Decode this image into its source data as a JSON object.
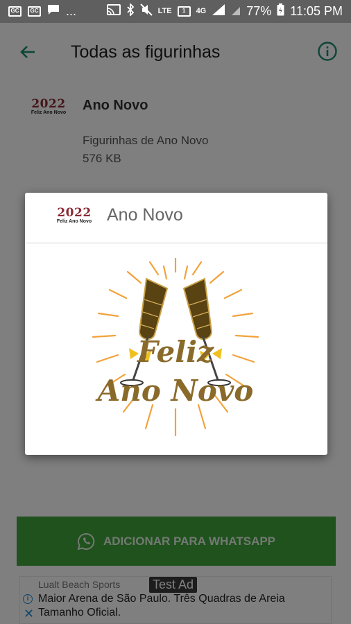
{
  "status_bar": {
    "ellipsis": "...",
    "network": "4G",
    "signal_label": "LTE",
    "battery": "77%",
    "time": "11:05 PM"
  },
  "toolbar": {
    "title": "Todas as figurinhas"
  },
  "pack": {
    "logo_year": "2022",
    "logo_caption": "Feliz Ano Novo",
    "name": "Ano Novo",
    "description": "Figurinhas de Ano Novo",
    "size": "576 KB"
  },
  "dialog": {
    "logo_year": "2022",
    "logo_caption": "Feliz Ano Novo",
    "title": "Ano Novo",
    "sticker_line1": "Feliz",
    "sticker_line2": "Ano Novo"
  },
  "add_button": {
    "label": "ADICIONAR PARA WHATSAPP"
  },
  "ad": {
    "sponsor": "Lualt Beach Sports",
    "badge": "Test Ad",
    "text": "Maior Arena de São Paulo. Três Quadras de Areia Tamanho Oficial."
  },
  "colors": {
    "accent": "#1b8a6f",
    "whatsapp_green": "#3fa53a",
    "sticker_gold": "#8a6a2a",
    "sticker_ray": "#f2a23a"
  }
}
